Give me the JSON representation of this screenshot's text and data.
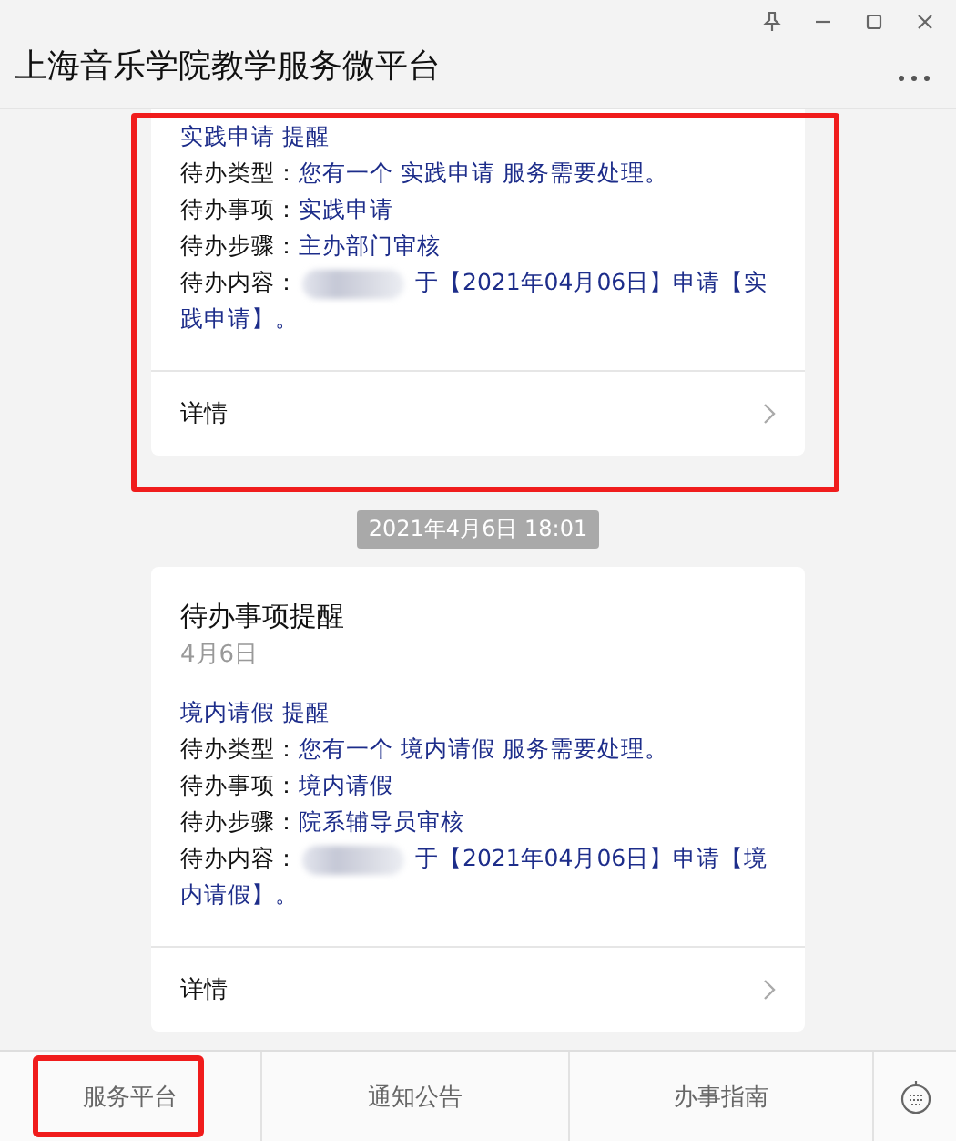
{
  "window": {
    "title": "上海音乐学院教学服务微平台"
  },
  "messages": [
    {
      "kind": "card",
      "highlighted": true,
      "heading": "实践申请 提醒",
      "fields": [
        {
          "label": "待办类型：",
          "value": "您有一个 实践申请 服务需要处理。",
          "redacted": false
        },
        {
          "label": "待办事项：",
          "value": "实践申请",
          "redacted": false
        },
        {
          "label": "待办步骤：",
          "value": "主办部门审核",
          "redacted": false
        },
        {
          "label": "待办内容：",
          "value": "于【2021年04月06日】申请【实践申请】。",
          "redacted": true
        }
      ],
      "link": "详情"
    },
    {
      "kind": "timestamp",
      "text": "2021年4月6日 18:01"
    },
    {
      "kind": "card",
      "highlighted": false,
      "title": "待办事项提醒",
      "date": "4月6日",
      "heading": "境内请假 提醒",
      "fields": [
        {
          "label": "待办类型：",
          "value": "您有一个 境内请假 服务需要处理。",
          "redacted": false
        },
        {
          "label": "待办事项：",
          "value": "境内请假",
          "redacted": false
        },
        {
          "label": "待办步骤：",
          "value": "院系辅导员审核",
          "redacted": false
        },
        {
          "label": "待办内容：",
          "value": "于【2021年04月06日】申请【境内请假】。",
          "redacted": true
        }
      ],
      "link": "详情"
    }
  ],
  "menu": [
    {
      "label": "服务平台",
      "highlighted": true
    },
    {
      "label": "通知公告",
      "highlighted": false
    },
    {
      "label": "办事指南",
      "highlighted": false
    }
  ]
}
